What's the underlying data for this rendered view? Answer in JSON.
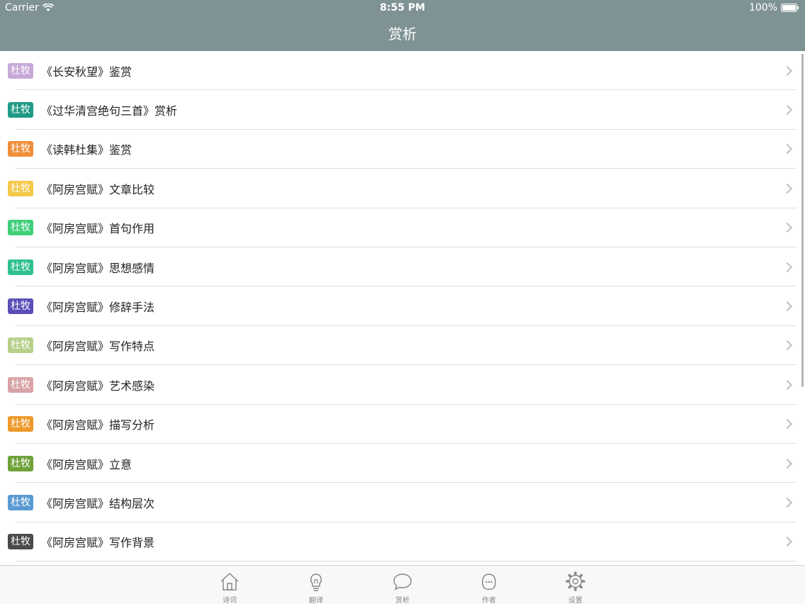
{
  "status": {
    "carrier": "Carrier",
    "time": "8:55 PM",
    "battery": "100%"
  },
  "nav": {
    "title": "赏析"
  },
  "rows": [
    {
      "tag": "杜牧",
      "title": "《长安秋望》鉴赏",
      "color": "#c6a9d9"
    },
    {
      "tag": "杜牧",
      "title": "《过华清宫绝句三首》赏析",
      "color": "#1f9a86"
    },
    {
      "tag": "杜牧",
      "title": "《读韩杜集》鉴赏",
      "color": "#f08e3a"
    },
    {
      "tag": "杜牧",
      "title": "《阿房宫赋》文章比较",
      "color": "#f5c84a"
    },
    {
      "tag": "杜牧",
      "title": "《阿房宫赋》首句作用",
      "color": "#3fcf7a"
    },
    {
      "tag": "杜牧",
      "title": "《阿房宫赋》思想感情",
      "color": "#2ec08e"
    },
    {
      "tag": "杜牧",
      "title": "《阿房宫赋》修辞手法",
      "color": "#5a4fb8"
    },
    {
      "tag": "杜牧",
      "title": "《阿房宫赋》写作特点",
      "color": "#b6d08a"
    },
    {
      "tag": "杜牧",
      "title": "《阿房宫赋》艺术感染",
      "color": "#d9a3a6"
    },
    {
      "tag": "杜牧",
      "title": "《阿房宫赋》描写分析",
      "color": "#ee9a2a"
    },
    {
      "tag": "杜牧",
      "title": "《阿房宫赋》立意",
      "color": "#6fa23a"
    },
    {
      "tag": "杜牧",
      "title": "《阿房宫赋》结构层次",
      "color": "#5a9ad3"
    },
    {
      "tag": "杜牧",
      "title": "《阿房宫赋》写作背景",
      "color": "#4a4a4a"
    }
  ],
  "tabs": [
    {
      "label": "诗词",
      "icon": "home-icon"
    },
    {
      "label": "翻译",
      "icon": "lightbulb-icon"
    },
    {
      "label": "赏析",
      "icon": "chat-bubble-icon"
    },
    {
      "label": "作者",
      "icon": "person-icon"
    },
    {
      "label": "设置",
      "icon": "gear-icon"
    }
  ]
}
